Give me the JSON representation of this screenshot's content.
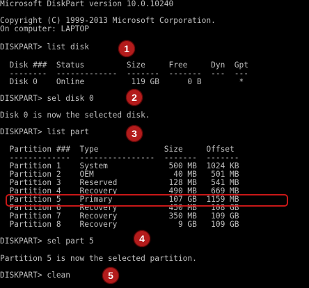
{
  "console": {
    "lines": [
      "Microsoft DiskPart version 10.0.10240",
      "",
      "Copyright (C) 1999-2013 Microsoft Corporation.",
      "On computer: LAPTOP",
      "",
      "DISKPART> list disk",
      "",
      "  Disk ###  Status         Size     Free     Dyn  Gpt",
      "  --------  -------------  -------  -------  ---  ---",
      "  Disk 0    Online          119 GB      0 B        *",
      "",
      "DISKPART> sel disk 0",
      "",
      "Disk 0 is now the selected disk.",
      "",
      "DISKPART> list part",
      "",
      "  Partition ###  Type              Size     Offset",
      "  -------------  ----------------  -------  -------",
      "  Partition 1    System             500 MB  1024 KB",
      "  Partition 2    OEM                 40 MB   501 MB",
      "  Partition 3    Reserved           128 MB   541 MB",
      "  Partition 4    Recovery           490 MB   669 MB",
      "  Partition 5    Primary            107 GB  1159 MB",
      "  Partition 6    Recovery           450 MB   108 GB",
      "  Partition 7    Recovery           350 MB   109 GB",
      "  Partition 8    Recovery             9 GB   109 GB",
      "",
      "DISKPART> sel part 5",
      "",
      "Partition 5 is now the selected partition.",
      "",
      "DISKPART> clean"
    ]
  },
  "step_badges": [
    "1",
    "2",
    "3",
    "4",
    "5"
  ],
  "colors": {
    "background": "#000000",
    "text": "#c0c0c0",
    "badge": "#b31c1c",
    "highlight_border": "#c81818"
  }
}
